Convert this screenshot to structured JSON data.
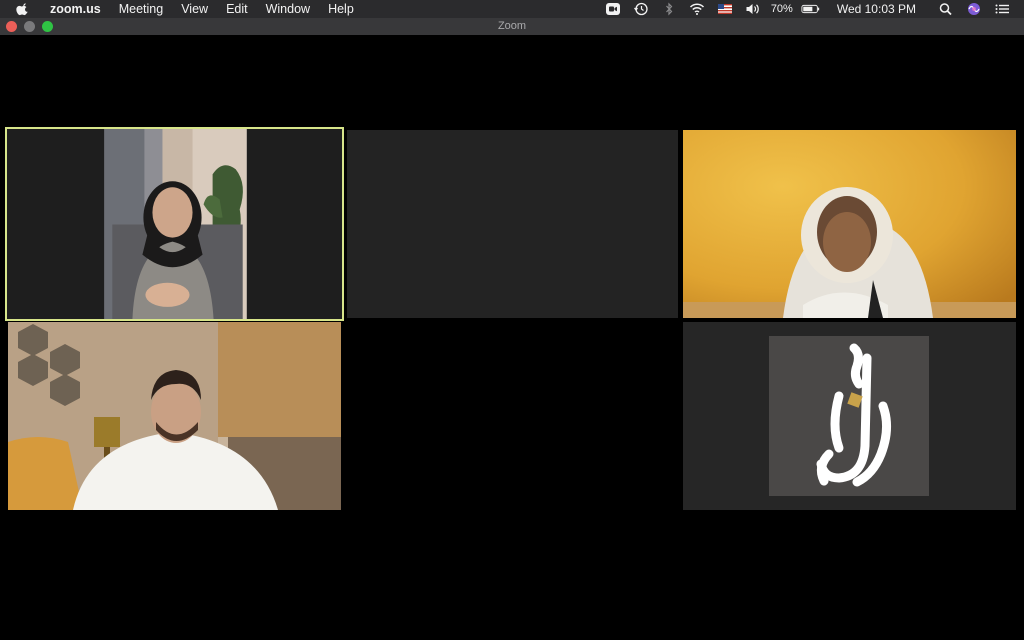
{
  "menubar": {
    "app_name": "zoom.us",
    "menus": [
      "Meeting",
      "View",
      "Edit",
      "Window",
      "Help"
    ],
    "battery_percent": "70%",
    "clock": "Wed 10:03 PM",
    "status_icons": [
      "zoom-icon",
      "time-machine-icon",
      "bluetooth-icon",
      "wifi-icon",
      "us-flag-input-icon",
      "volume-icon",
      "battery-icon",
      "spotlight-search-icon",
      "siri-icon",
      "notification-center-icon"
    ]
  },
  "window": {
    "title": "Zoom"
  },
  "participants": [
    {
      "id": "participant-1",
      "state": "video",
      "active_speaker": true
    },
    {
      "id": "participant-2",
      "state": "empty",
      "active_speaker": false
    },
    {
      "id": "participant-3",
      "state": "video",
      "active_speaker": false
    },
    {
      "id": "participant-4",
      "state": "video",
      "active_speaker": false
    },
    {
      "id": "participant-5",
      "state": "logo",
      "active_speaker": false
    }
  ],
  "colors": {
    "active_speaker_border": "#d7e58a",
    "menubar_bg": "#2b2b2d",
    "titlebar_bg": "#38383a",
    "empty_tile_bg": "#232323"
  }
}
